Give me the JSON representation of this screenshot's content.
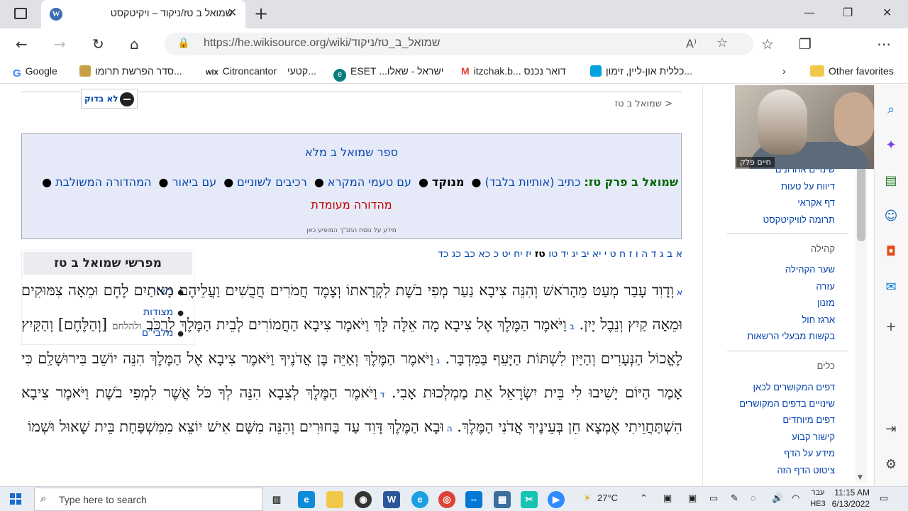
{
  "browser": {
    "tab_title": "שמואל ב טז/ניקוד – ויקיטקסט",
    "tab_close": "✕",
    "new_tab": "+",
    "minimize": "—",
    "maximize": "❐",
    "close": "✕",
    "url": "https://he.wikisource.org/wiki/שמואל_ב_טז/ניקוד",
    "read_aloud": "A⁾",
    "more": "⋯",
    "bookmarks": [
      {
        "label": "Google",
        "color": "#4285f4",
        "glyph": "G"
      },
      {
        "label": "סדר הפרשת תרומו...",
        "color": "#c8a046",
        "glyph": ""
      },
      {
        "label": "Citroncantor",
        "color": "#ffffff",
        "glyph": "wix"
      },
      {
        "label": "קטעי...",
        "color": "#ffffff",
        "glyph": ""
      },
      {
        "label": "ESET ...ישראל - שאלו",
        "color": "#0b7c7c",
        "glyph": "e"
      },
      {
        "label": "itzchak.b... דואר נכנס",
        "color": "#ea4335",
        "glyph": "M"
      },
      {
        "label": "כללית און-ליין, זימון...",
        "color": "#00a3e0",
        "glyph": ""
      }
    ],
    "other_favorites": "Other favorites"
  },
  "page": {
    "unchecked_label": "לא בדוק",
    "breadcrumb": "< שמואל ב טז",
    "box_title": "ספר שמואל ב מלא",
    "box_lead": "שמואל ב פרק טז:",
    "box_links": [
      "כתיב (אותיות בלבד)",
      "מנוקד",
      "עם טעמי המקרא",
      "רכיבים לשוניים",
      "עם ביאור",
      "המהדורה המשולבת"
    ],
    "box_red": "מהדורה מעומדת",
    "box_small": "מידע על נוסח התנ\"ך המופיע כאן",
    "chapters": [
      "א",
      "ב",
      "ג",
      "ד",
      "ה",
      "ו",
      "ז",
      "ח",
      "ט",
      "י",
      "יא",
      "יב",
      "יג",
      "יד",
      "טו",
      "טז",
      "יז",
      "יח",
      "יט",
      "כ",
      "כא",
      "כב",
      "כג",
      "כד"
    ],
    "current_chapter": "טז",
    "commentaries_title": "מפרשי שמואל ב טז",
    "commentaries": [
      "רש\"י",
      "מצודות",
      "מלבי\"ם"
    ],
    "verses": [
      {
        "n": "א",
        "text": "וְדָוִד עָבַר מְעַט מֵהָרֹאשׁ וְהִנֵּה צִיבָא נַעַר מְפִי בֹשֶׁת לִקְרָאתוֹ וְצֶמֶד חֲמֹרִים חֲבֻשִׁים וַעֲלֵיהֶם מָאתַיִם לֶחֶם וּמֵאָה צִמּוּקִים וּמֵאָה קַיִץ וְנֵבֶל יָיִן."
      },
      {
        "n": "ב",
        "text": "וַיֹּאמֶר הַמֶּלֶךְ אֶל צִיבָא מָה אֵלֶּה לָּךְ וַיֹּאמֶר צִיבָא הַחֲמוֹרִים לְבֵית הַמֶּלֶךְ לִרְכֹּב",
        "k": "ולהלחם",
        "text2": "[וְהַלֶּחֶם] וְהַקַּיִץ לֶאֱכוֹל הַנְּעָרִים וְהַיַּיִן לִשְׁתּוֹת הַיָּעֵף בַּמִּדְבָּר."
      },
      {
        "n": "ג",
        "text": "וַיֹּאמֶר הַמֶּלֶךְ וְאַיֵּה בֶּן אֲדֹנֶיךָ וַיֹּאמֶר צִיבָא אֶל הַמֶּלֶךְ הִנֵּה יוֹשֵׁב בִּירוּשָׁלִַם כִּי אָמַר הַיּוֹם יָשִׁיבוּ לִי בֵּית יִשְׂרָאֵל אֵת מַמְלְכוּת אָבִי."
      },
      {
        "n": "ד",
        "text": "וַיֹּאמֶר הַמֶּלֶךְ לְצִבָא הִנֵּה לְךָ כֹּל אֲשֶׁר לִמְפִי בֹשֶׁת וַיֹּאמֶר צִיבָא הִשְׁתַּחֲוֵיתִי אֶמְצָא חֵן בְּעֵינֶיךָ אֲדֹנִי הַמֶּלֶךְ."
      },
      {
        "n": "ה",
        "text": "וּבָא הַמֶּלֶךְ דָּוִד עַד בַּחוּרִים וְהִנֵּה מִשָּׁם אִישׁ יוֹצֵא מִמִּשְׁפַּחַת בֵּית שָׁאוּל וּשְׁמוֹ"
      }
    ]
  },
  "sidebar": {
    "tools_top": [
      "שינויים אחרונים",
      "דיווח על טעות",
      "דף אקראי",
      "תרומה לוויקיטקסט"
    ],
    "community_header": "קהילה",
    "community": [
      "שער הקהילה",
      "עזרה",
      "מזנון",
      "ארגז חול",
      "בקשות מבעלי הרשאות"
    ],
    "tools_header": "כלים",
    "tools": [
      "דפים המקושרים לכאן",
      "שינויים בדפים המקושרים",
      "דפים מיוחדים",
      "קישור קבוע",
      "מידע על הדף",
      "ציטוט הדף הזה"
    ]
  },
  "video": {
    "name": "חיים פלק"
  },
  "taskbar": {
    "search_placeholder": "Type here to search",
    "temperature": "27°C",
    "lang_top": "עבר",
    "lang_bottom": "HE3",
    "time": "11:15 AM",
    "date": "6/13/2022"
  },
  "colors": {
    "link": "#0645ad",
    "box_bg": "#e6eaf8",
    "red": "#ba0000"
  }
}
